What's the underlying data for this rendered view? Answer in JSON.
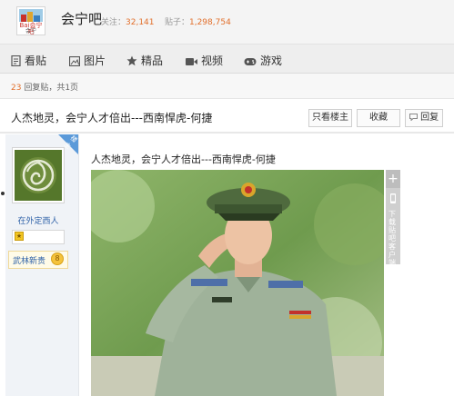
{
  "header": {
    "logo_text": "Bai会宁吧",
    "logo_sub": "会宁",
    "forum_name": "会宁吧",
    "follow_label": "关注：",
    "follow_count": "32,141",
    "posts_label": "贴子：",
    "posts_count": "1,298,754"
  },
  "nav": {
    "items": [
      {
        "label": "看贴",
        "icon": "document-icon"
      },
      {
        "label": "图片",
        "icon": "image-icon"
      },
      {
        "label": "精品",
        "icon": "star-icon"
      },
      {
        "label": "视频",
        "icon": "video-icon"
      },
      {
        "label": "游戏",
        "icon": "gamepad-icon"
      }
    ]
  },
  "reply_bar": {
    "count": "23",
    "text": "回复贴，共1页"
  },
  "thread": {
    "title": "人杰地灵，会宁人才倍出---西南悍虎-何捷",
    "buttons": {
      "only_owner": "只看楼主",
      "favorite": "收藏",
      "reply": "回复"
    }
  },
  "author": {
    "badge": "楼主",
    "name": "在外定西人",
    "level_icon": "level-badge-icon",
    "rank_title": "武林新贵",
    "rank_level": "8"
  },
  "post": {
    "text": "人杰地灵，会宁人才倍出---西南悍虎-何捷"
  },
  "side_tools": {
    "plus": "+",
    "vertical_text": "下载贴吧客户端"
  },
  "colors": {
    "accent_orange": "#e26f2b",
    "link_blue": "#2f62a8",
    "badge_blue": "#5b9ad9"
  }
}
